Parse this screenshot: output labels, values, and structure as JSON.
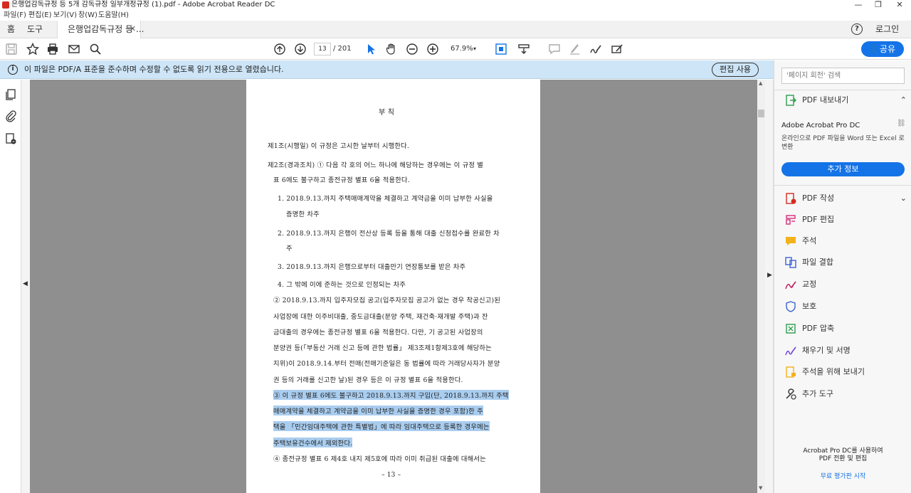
{
  "window": {
    "title": "은행업감독규정 등 5개 감독규정 일부개정규정 (1).pdf - Adobe Acrobat Reader DC",
    "controls": [
      "—",
      "❐",
      "✕"
    ]
  },
  "menu": [
    "파일(F)",
    "편집(E)",
    "보기(V)",
    "창(W)",
    "도움말(H)"
  ],
  "tabs": {
    "home": "홈",
    "tools": "도구",
    "document": "은행업감독규정 등 ...",
    "close": "✕"
  },
  "header_right": {
    "help": "?",
    "login": "로그인"
  },
  "toolbar": {
    "page_current": "13",
    "page_total": "/ 201",
    "zoom": "67.9%",
    "share_label": "공유"
  },
  "infobar": {
    "message": "이 파일은 PDF/A 표준을 준수하며 수정할 수 없도록 읽기 전용으로 열렸습니다.",
    "edit_button": "편집 사용"
  },
  "document": {
    "heading": "부     칙",
    "lines": [
      "제1조(시행일) 이 규정은 고시한 날부터 시행한다.",
      "제2조(경과조치) ① 다음 각 호의 어느 하나에 해당하는 경우에는 이 규정 별",
      "표 6에도 불구하고 종전규정 별표 6을 적용한다.",
      "1. 2018.9.13.까지 주택매매계약을 체결하고 계약금을 이미 납부한 사실을",
      "증명한 차주",
      "2. 2018.9.13.까지 은행이 전산상 등록 등을 통해 대출 신청접수를 완료한 차",
      "주",
      "3. 2018.9.13.까지 은행으로부터 대출만기 연장통보를 받은 차주",
      "4. 그 밖에 이에 준하는 것으로 인정되는 차주",
      "② 2018.9.13.까지 입주자모집 공고(입주자모집 공고가 없는 경우 착공신고)된",
      "사업장에 대한 이주비대출, 중도금대출(분양 주택, 재건축·재개발 주택)과 잔",
      "금대출의 경우에는 종전규정 별표 6을 적용한다. 다만, 기 공고된 사업장의",
      "분양권 등(「부동산 거래 신고 등에 관한 법률」 제3조제1항제3호에 해당하는",
      "지위)이 2018.9.14.부터 전매(전매기준일은 동 법률에 따라 거래당사자가 분양",
      "권 등의 거래를 신고한 날)된 경우 등은 이 규정 별표 6을 적용한다.",
      "③ 이 규정 별표 6에도 불구하고 2018.9.13.까지 구입(단, 2018.9.13.까지 주택",
      "매매계약을 체결하고 계약금을 이미 납부한 사실을 증명한 경우 포함)한 주",
      "택을 「민간임대주택에 관한 특별법」에 따라 임대주택으로 등록한 경우에는",
      "주택보유건수에서 제외한다.",
      "④ 종전규정 별표 6 제4호 내지 제5호에 따라 이미 취급된 대출에 대해서는"
    ],
    "page_number": "– 13 –"
  },
  "right_panel": {
    "search_placeholder": "'페이지 회전' 검색",
    "export_label": "PDF 내보내기",
    "promo_title": "Adobe Acrobat Pro DC",
    "promo_desc": "온라인으로 PDF 파일을 Word 또는 Excel 로 변환",
    "promo_button": "추가 정보",
    "tools": [
      "PDF 작성",
      "PDF 편집",
      "주석",
      "파일 결합",
      "교정",
      "보호",
      "PDF 압축",
      "채우기 및 서명",
      "주석을 위해 보내기",
      "추가 도구"
    ],
    "footer_line1": "Acrobat Pro DC를 사용하여",
    "footer_line2": "PDF 전환 및 편집",
    "footer_link": "무료 평가판 시작"
  },
  "colors": {
    "accent": "#1473e6",
    "infobar_bg": "#cde5f7",
    "highlight": "#a9cdef",
    "doc_bg": "#8f8f8f"
  }
}
